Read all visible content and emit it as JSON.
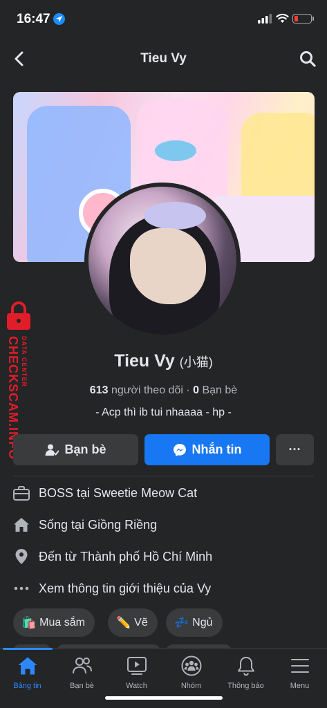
{
  "status_bar": {
    "time": "16:47"
  },
  "nav": {
    "title": "Tieu Vy"
  },
  "profile": {
    "name": "Tieu Vy",
    "alt_name": "(小猫)",
    "followers_count": "613",
    "followers_label": "người theo dõi",
    "separator": "·",
    "friends_count": "0",
    "friends_label": "Bạn bè",
    "bio": "- Acp thì ib tui nhaaaa - hp -"
  },
  "actions": {
    "friends_label": "Bạn bè",
    "message_label": "Nhắn tin",
    "more_label": "···"
  },
  "info": {
    "work_prefix": "BOSS tại",
    "work_place": "Sweetie Meow Cat",
    "lives_prefix": "Sống tại",
    "lives_place": "Giồng Riềng",
    "from_prefix": "Đến từ",
    "from_place": "Thành phố Hồ Chí Minh",
    "about_label": "Xem thông tin giới thiệu của Vy"
  },
  "hobbies": [
    {
      "emoji": "🛍️",
      "label": "Mua sắm"
    },
    {
      "emoji": "✏️",
      "label": "Vẽ"
    },
    {
      "emoji": "💤",
      "label": "Ngủ"
    }
  ],
  "tabbar": {
    "home": "Bảng tin",
    "friends": "Bạn bè",
    "watch": "Watch",
    "groups": "Nhóm",
    "notifications": "Thông báo",
    "menu": "Menu"
  },
  "watermark": {
    "main": "CHECKSCAM.INFO",
    "sub": "DATA CENTER"
  },
  "colors": {
    "accent": "#1877f2",
    "active_tab": "#2d88ff",
    "background": "#242526",
    "watermark": "#e11d2a"
  }
}
